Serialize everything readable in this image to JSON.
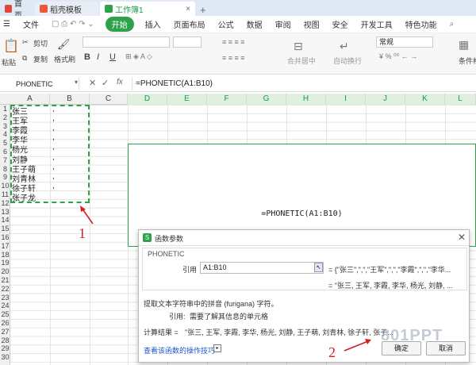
{
  "tabs": {
    "home": "首页",
    "template": "稻壳模板",
    "workbook": "工作簿1"
  },
  "menu": {
    "file": "文件",
    "start": "开始",
    "insert": "插入",
    "layout": "页面布局",
    "formula": "公式",
    "data": "数据",
    "review": "审阅",
    "view": "视图",
    "security": "安全",
    "devtools": "开发工具",
    "features": "特色功能"
  },
  "ribbon": {
    "cut": "剪切",
    "copy": "复制",
    "paste": "粘贴",
    "format_painter": "格式刷",
    "bold": "B",
    "italic": "I",
    "underline": "U",
    "merge_center": "合并居中",
    "wrap": "自动换行",
    "number_format": "常规",
    "percent": "%",
    "condformat": "条件格"
  },
  "formula_bar": {
    "name_box": "PHONETIC",
    "fx": "fx",
    "formula": "=PHONETIC(A1:B10)"
  },
  "columns": [
    "A",
    "B",
    "C",
    "D",
    "E",
    "F",
    "G",
    "H",
    "I",
    "J",
    "K",
    "L"
  ],
  "rows": [
    "1",
    "2",
    "3",
    "4",
    "5",
    "6",
    "7",
    "8",
    "9",
    "10",
    "11",
    "12",
    "13",
    "14",
    "15",
    "16",
    "17",
    "18",
    "19",
    "20",
    "21",
    "22",
    "23",
    "24",
    "25",
    "26",
    "27",
    "28",
    "29",
    "30"
  ],
  "cells": {
    "colA": [
      "张三",
      "王军",
      "李霞",
      "李华",
      "杨光",
      "刘静",
      "王子萌",
      "刘青林",
      "徐子轩",
      "张子龙"
    ],
    "colB": [
      ",",
      ",",
      ",",
      ",",
      ",",
      ",",
      ",",
      ",",
      ","
    ]
  },
  "bigcell_text": "=PHONETIC(A1:B10)",
  "dialog": {
    "title": "函数参数",
    "func_name": "PHONETIC",
    "ref_label": "引用",
    "ref_value": "A1:B10",
    "ref_result": "= {\"张三\",\",\",\"王军\",\",\",\"李霞\",\",\",\"李华...",
    "preview": "= \"张三, 王军, 李霞, 李华, 杨光, 刘静, ...",
    "description": "提取文本字符串中的拼音 (furigana) 字符。",
    "param_desc_label": "引用:",
    "param_desc": "需要了解其信息的单元格",
    "calc_result_label": "计算结果 =",
    "calc_result": "\"张三, 王军, 李霞, 李华, 杨光, 刘静, 王子萌, 刘青林, 徐子轩, 张子...",
    "help_link": "查看该函数的操作技巧",
    "ok": "确定",
    "cancel": "取消"
  },
  "annotations": {
    "one": "1",
    "two": "2"
  },
  "watermark": "801PPT"
}
